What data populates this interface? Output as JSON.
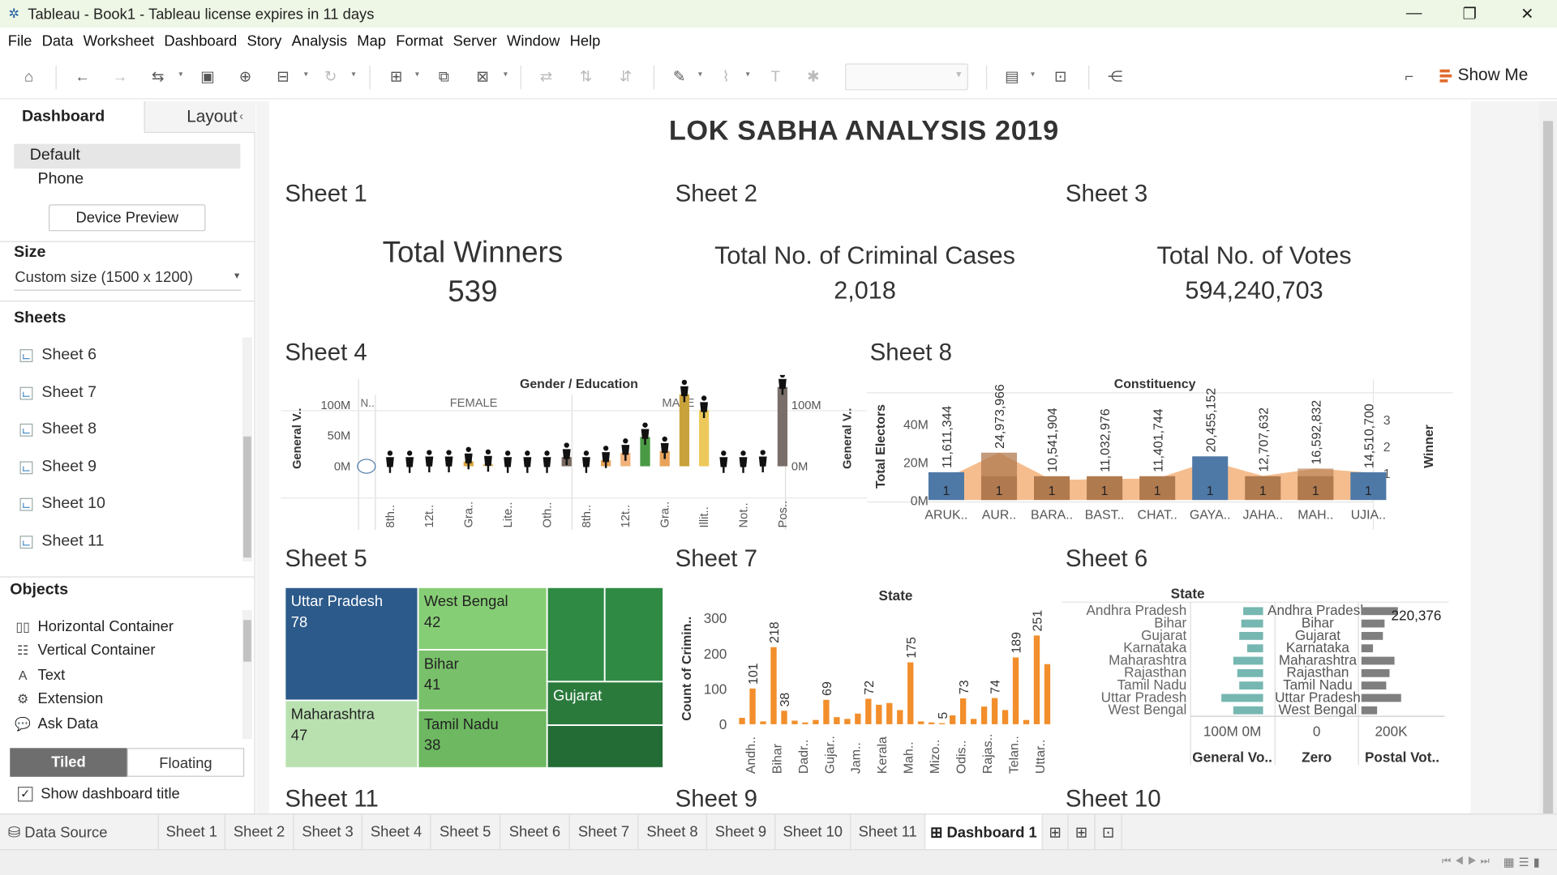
{
  "window": {
    "title": "Tableau - Book1 - Tableau license expires in 11 days",
    "controls": {
      "minimize": "—",
      "restore": "❐",
      "close": "✕"
    }
  },
  "menu": [
    "File",
    "Data",
    "Worksheet",
    "Dashboard",
    "Story",
    "Analysis",
    "Map",
    "Format",
    "Server",
    "Window",
    "Help"
  ],
  "toolbar": {
    "show_me_label": "Show Me"
  },
  "left_pane": {
    "tabs": {
      "dashboard": "Dashboard",
      "layout": "Layout"
    },
    "device_options": {
      "default": "Default",
      "phone": "Phone"
    },
    "device_preview_label": "Device Preview",
    "size": {
      "heading": "Size",
      "value": "Custom size (1500 x 1200)"
    },
    "sheets": {
      "heading": "Sheets",
      "items": [
        "Sheet 6",
        "Sheet 7",
        "Sheet 8",
        "Sheet 9",
        "Sheet 10",
        "Sheet 11"
      ]
    },
    "objects": {
      "heading": "Objects",
      "items": [
        "Horizontal Container",
        "Vertical Container",
        "Text",
        "Extension",
        "Ask Data"
      ]
    },
    "layout_mode": {
      "tiled": "Tiled",
      "floating": "Floating"
    },
    "show_title": {
      "label": "Show dashboard title",
      "checked": true
    }
  },
  "dashboard": {
    "title": "LOK SABHA ANALYSIS 2019",
    "sheet1": {
      "title": "Sheet 1",
      "label": "Total Winners",
      "value": "539"
    },
    "sheet2": {
      "title": "Sheet 2",
      "label": "Total No. of Criminal Cases",
      "value": "2,018"
    },
    "sheet3": {
      "title": "Sheet 3",
      "label": "Total No. of Votes",
      "value": "594,240,703"
    },
    "sheet4_title": "Sheet 4",
    "sheet8_title": "Sheet 8",
    "sheet5_title": "Sheet 5",
    "sheet7_title": "Sheet 7",
    "sheet6_title": "Sheet 6",
    "sheet11_title": "Sheet 11",
    "sheet9_title": "Sheet 9",
    "sheet10_title": "Sheet 10"
  },
  "chart_data": [
    {
      "type": "bar",
      "name": "Sheet 4",
      "title": "Gender / Education",
      "ylabel": "General V..",
      "y_ticks": [
        "0M",
        "50M",
        "100M"
      ],
      "y_ticks_right": [
        "0M",
        "100M"
      ],
      "ylim": [
        0,
        130
      ],
      "groups": [
        "N..",
        "FEMALE",
        "MALE"
      ],
      "categories": [
        "N.",
        "8th..",
        "",
        "12t..",
        "",
        "Gra..",
        "",
        "Lite..",
        "",
        "Oth..",
        "",
        "8th..",
        "",
        "12t..",
        "",
        "Gra..",
        "",
        "Illit..",
        "",
        "Not..",
        "",
        "Pos.."
      ],
      "values": [
        0,
        2,
        2,
        3,
        3,
        8,
        4,
        2,
        2,
        2,
        15,
        2,
        10,
        22,
        48,
        25,
        118,
        92,
        2,
        2,
        3,
        130
      ],
      "colors": [
        "#4e79a7",
        "#e8a35b",
        "#e8a35b",
        "#f0c27a",
        "#f0c27a",
        "#d9a640",
        "#e0c17d",
        "#e8a35b",
        "#e8a35b",
        "#a9a9a9",
        "#7a6a60",
        "#e8a35b",
        "#e8a35b",
        "#f0b27a",
        "#4a9a45",
        "#e8a35b",
        "#c9a23b",
        "#ecc95a",
        "#e8a35b",
        "#e8a35b",
        "#d9534f",
        "#7a6e6a"
      ]
    },
    {
      "type": "area",
      "name": "Sheet 8",
      "title": "Constituency",
      "ylabel": "Total Electors",
      "y2label": "Winner",
      "y_ticks": [
        "0M",
        "20M",
        "40M"
      ],
      "y2_ticks": [
        "1",
        "2",
        "3"
      ],
      "ylim": [
        0,
        45
      ],
      "categories": [
        "ARUK..",
        "AUR..",
        "BARA..",
        "BAST..",
        "CHAT..",
        "GAYA..",
        "JAHA..",
        "MAH..",
        "UJIA.."
      ],
      "values": [
        11.611344,
        24.973966,
        10.541904,
        11.032976,
        11.401744,
        20.455152,
        12.707632,
        16.592832,
        14.5107
      ],
      "data_labels": [
        "11,611,344",
        "24,973,966",
        "10,541,904",
        "11,032,976",
        "11,401,744",
        "20,455,152",
        "12,707,632",
        "16,592,832",
        "14,510,700"
      ],
      "winner_counts": [
        1,
        1,
        1,
        1,
        1,
        1,
        1,
        1,
        1
      ],
      "colors": {
        "bar_blue": "#4e79a7",
        "bar_brown": "#b07a4f",
        "area": "#f3b27a"
      }
    },
    {
      "type": "treemap",
      "name": "Sheet 5",
      "cells": [
        {
          "label": "Uttar Pradesh",
          "value": "78",
          "color": "#2c5a8a"
        },
        {
          "label": "West Bengal",
          "value": "42",
          "color": "#86ce75"
        },
        {
          "label": "Bihar",
          "value": "41",
          "color": "#79c06a"
        },
        {
          "label": "Maharashtra",
          "value": "47",
          "color": "#b9e1b0"
        },
        {
          "label": "Tamil Nadu",
          "value": "38",
          "color": "#6db861"
        },
        {
          "label": "Gujarat",
          "value": "",
          "color": "#2a7a3c"
        },
        {
          "label": "",
          "value": "",
          "color": "#2f8a44"
        },
        {
          "label": "",
          "value": "",
          "color": "#2f8a44"
        },
        {
          "label": "",
          "value": "",
          "color": "#236c35"
        }
      ]
    },
    {
      "type": "bar",
      "name": "Sheet 7",
      "title": "State",
      "ylabel": "Count of Crimin..",
      "y_ticks": [
        "0",
        "100",
        "200",
        "300"
      ],
      "ylim": [
        0,
        320
      ],
      "categories": [
        "Andh..",
        "Bihar",
        "Dadr..",
        "Gujar..",
        "Jam..",
        "Kerala",
        "Mah..",
        "Mizo..",
        "Odis..",
        "Rajas..",
        "Telan..",
        "Uttar.."
      ],
      "values": [
        18,
        101,
        8,
        218,
        38,
        10,
        5,
        12,
        69,
        20,
        15,
        30,
        72,
        55,
        60,
        40,
        175,
        8,
        5,
        3,
        25,
        73,
        15,
        50,
        74,
        40,
        189,
        12,
        251,
        170
      ],
      "label_indices": [
        1,
        3,
        4,
        8,
        12,
        16,
        19,
        21,
        24,
        26,
        28
      ],
      "label_values": [
        "101",
        "218",
        "38",
        "69",
        "72",
        "175",
        "5",
        "73",
        "74",
        "189",
        "251"
      ],
      "color": "#f28e2b"
    },
    {
      "type": "bar",
      "name": "Sheet 6",
      "title": "State",
      "categories": [
        "Andhra Pradesh",
        "Bihar",
        "Gujarat",
        "Karnataka",
        "Maharashtra",
        "Rajasthan",
        "Tamil Nadu",
        "Uttar Pradesh",
        "West Bengal"
      ],
      "panes": [
        {
          "label": "General Vo..",
          "ticks": [
            "100M",
            "0M"
          ],
          "values": [
            20,
            22,
            24,
            16,
            30,
            26,
            24,
            42,
            30
          ],
          "color": "#76b7b2"
        },
        {
          "label": "Zero",
          "ticks": [
            "0"
          ],
          "values": [
            0,
            0,
            0,
            0,
            0,
            0,
            0,
            0,
            0
          ]
        },
        {
          "label": "Postal Vot..",
          "ticks": [
            "200K"
          ],
          "values": [
            220376,
            140000,
            130000,
            70000,
            200000,
            170000,
            150000,
            240000,
            95000
          ],
          "color": "#7f7f7f"
        }
      ],
      "data_label": "220,376"
    }
  ],
  "tabs": {
    "data_source": "Data Source",
    "sheets": [
      "Sheet 1",
      "Sheet 2",
      "Sheet 3",
      "Sheet 4",
      "Sheet 5",
      "Sheet 6",
      "Sheet 7",
      "Sheet 8",
      "Sheet 9",
      "Sheet 10",
      "Sheet 11"
    ],
    "active": "Dashboard 1"
  }
}
